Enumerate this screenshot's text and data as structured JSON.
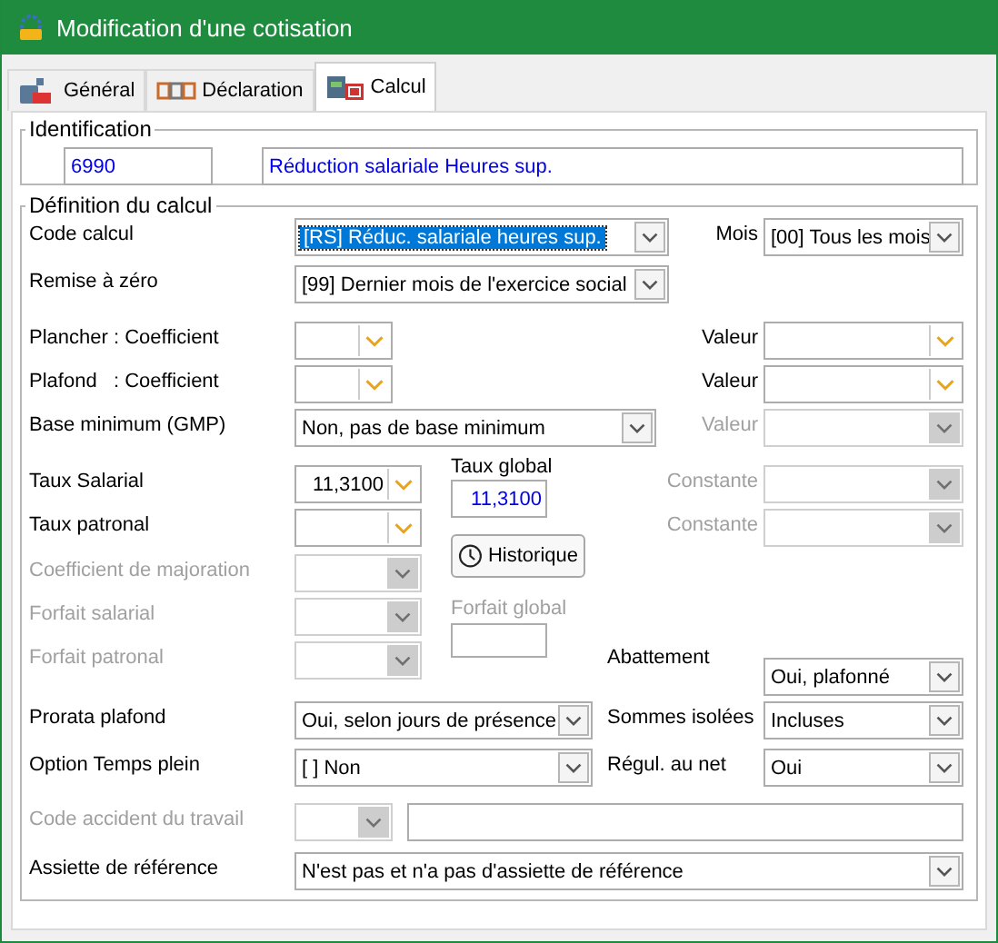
{
  "window": {
    "title": "Modification d'une cotisation"
  },
  "tabs": [
    {
      "label": "Général",
      "selected": false
    },
    {
      "label": "Déclaration",
      "selected": false
    },
    {
      "label": "Calcul",
      "selected": true
    }
  ],
  "identification": {
    "title": "Identification",
    "code": "6990",
    "name": "Réduction salariale Heures sup."
  },
  "definition": {
    "title": "Définition du calcul",
    "rows": [
      {
        "label": "Code calcul",
        "disabled": false,
        "field": {
          "kind": "dropdown",
          "value": "[RS]  Réduc. salariale heures sup.",
          "focused": true,
          "disabled": false
        },
        "right": {
          "label": "Mois",
          "disabled": false,
          "field": {
            "kind": "dropdown",
            "value": "[00] Tous les mois",
            "disabled": false
          }
        }
      },
      {
        "label": "Remise à zéro",
        "disabled": false,
        "field": {
          "kind": "dropdown",
          "value": "[99] Dernier mois de l'exercice social",
          "disabled": false
        }
      },
      {
        "label": "Plancher : Coefficient",
        "disabled": false,
        "field": {
          "kind": "editable",
          "disabled": false
        },
        "right": {
          "label": "Valeur",
          "disabled": false,
          "field": {
            "kind": "editable",
            "disabled": false
          }
        }
      },
      {
        "label": "Plafond   : Coefficient",
        "disabled": false,
        "field": {
          "kind": "editable",
          "disabled": false
        },
        "right": {
          "label": "Valeur",
          "disabled": false,
          "field": {
            "kind": "editable",
            "disabled": false
          }
        }
      },
      {
        "label": "Base minimum (GMP)",
        "disabled": false,
        "field": {
          "kind": "dropdown",
          "value": "Non, pas de base minimum",
          "disabled": false
        },
        "right": {
          "label": "Valeur",
          "disabled": true,
          "field": {
            "kind": "dropdown",
            "disabled": true
          }
        }
      },
      {
        "label": "Taux Salarial",
        "disabled": false,
        "field": {
          "kind": "editable",
          "value": "11,3100",
          "disabled": false
        },
        "right": {
          "label": "Constante",
          "disabled": true,
          "field": {
            "kind": "dropdown",
            "disabled": true
          }
        }
      },
      {
        "label": "Taux patronal",
        "disabled": false,
        "field": {
          "kind": "editable",
          "disabled": false
        },
        "right": {
          "label": "Constante",
          "disabled": true,
          "field": {
            "kind": "dropdown",
            "disabled": true
          }
        }
      },
      {
        "label": "Coefficient de majoration",
        "disabled": true,
        "field": {
          "kind": "dropdown",
          "disabled": true
        }
      },
      {
        "label": "Forfait salarial",
        "disabled": true,
        "field": {
          "kind": "dropdown",
          "disabled": true
        }
      },
      {
        "label": "Forfait patronal",
        "disabled": true,
        "field": {
          "kind": "dropdown",
          "disabled": true
        },
        "right": {
          "label": "Abattement",
          "disabled": false,
          "field": {
            "kind": "dropdown",
            "value": "Oui, plafonné",
            "disabled": false
          }
        }
      },
      {
        "label": "Prorata plafond",
        "disabled": false,
        "field": {
          "kind": "dropdown",
          "value": "Oui, selon jours de présence",
          "disabled": false
        },
        "right": {
          "label": "Sommes isolées",
          "disabled": false,
          "field": {
            "kind": "dropdown",
            "value": "Incluses",
            "disabled": false
          }
        }
      },
      {
        "label": "Option Temps plein",
        "disabled": false,
        "field": {
          "kind": "dropdown",
          "value": "[    ] Non",
          "disabled": false
        },
        "right": {
          "label": "Régul. au net",
          "disabled": false,
          "field": {
            "kind": "dropdown",
            "value": "Oui",
            "disabled": false
          }
        }
      },
      {
        "label": "Code accident du travail",
        "disabled": true,
        "field": {
          "kind": "dropdown",
          "disabled": true
        },
        "extra": {
          "kind": "text"
        }
      },
      {
        "label": "Assiette de référence",
        "disabled": false,
        "field": {
          "kind": "dropdown",
          "value": "N'est pas et n'a pas d'assiette de référence",
          "disabled": false
        }
      }
    ]
  },
  "taux_global": {
    "label": "Taux global",
    "value": "11,3100"
  },
  "historique_button": {
    "label": "Historique"
  },
  "forfait_global": {
    "label": "Forfait global",
    "disabled": true
  }
}
